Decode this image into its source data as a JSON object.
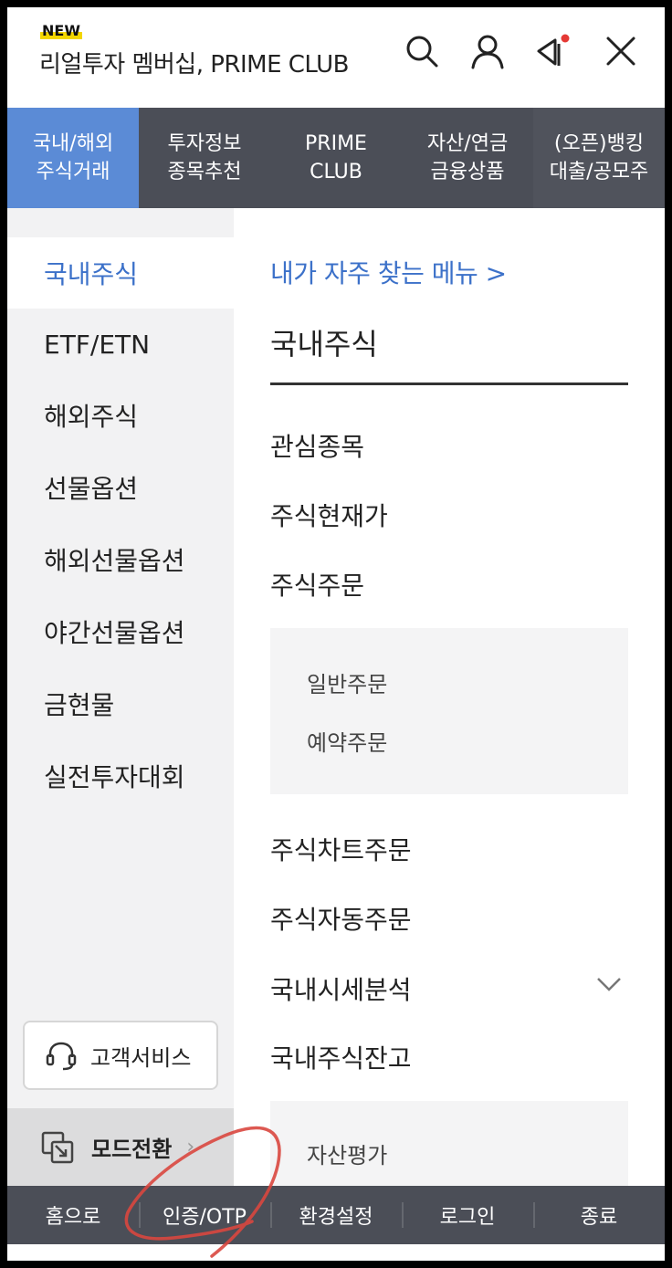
{
  "header": {
    "badge": "NEW",
    "title": "리얼투자 멤버십, PRIME CLUB",
    "icons": [
      "search-icon",
      "user-icon",
      "megaphone-icon",
      "close-icon"
    ],
    "notification_dot_color": "#e53935"
  },
  "tabs": [
    {
      "line1": "국내/해외",
      "line2": "주식거래"
    },
    {
      "line1": "투자정보",
      "line2": "종목추천"
    },
    {
      "line1": "PRIME",
      "line2": "CLUB"
    },
    {
      "line1": "자산/연금",
      "line2": "금융상품"
    },
    {
      "line1": "(오픈)뱅킹",
      "line2": "대출/공모주"
    }
  ],
  "sidebar": {
    "items": [
      "국내주식",
      "ETF/ETN",
      "해외주식",
      "선물옵션",
      "해외선물옵션",
      "야간선물옵션",
      "금현물",
      "실전투자대회"
    ],
    "customer_service": "고객서비스",
    "mode_switch": "모드전환",
    "mode_chevron": "›"
  },
  "content": {
    "favorites_link": "내가 자주 찾는 메뉴 >",
    "section_title": "국내주식",
    "items": {
      "watchlist": "관심종목",
      "current_price": "주식현재가",
      "order": "주식주문",
      "chart_order": "주식차트주문",
      "auto_order": "주식자동주문",
      "market_analysis": "국내시세분석",
      "balance": "국내주식잔고"
    },
    "order_sub": [
      "일반주문",
      "예약주문"
    ],
    "balance_sub": [
      "자산평가"
    ]
  },
  "bottombar": [
    "홈으로",
    "인증/OTP",
    "환경설정",
    "로그인",
    "종료"
  ],
  "colors": {
    "accent": "#3c71c9",
    "active_tab": "#5b8bd6",
    "bar": "#4b4e57",
    "annotation": "#d9473f"
  }
}
